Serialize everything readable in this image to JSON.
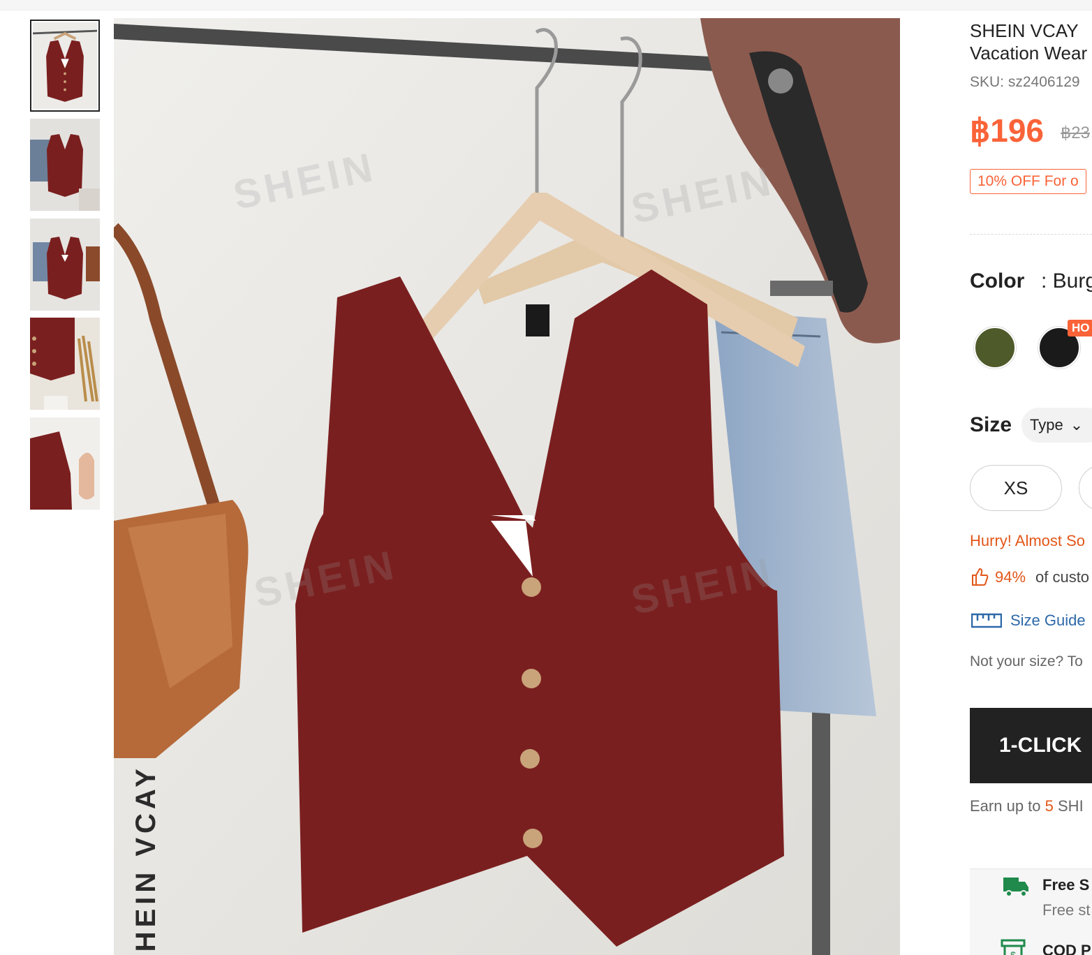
{
  "thumbnails": [
    {
      "alt": "Vest front view"
    },
    {
      "alt": "Vest with skirt"
    },
    {
      "alt": "Vest outfit"
    },
    {
      "alt": "Vest detail"
    },
    {
      "alt": "Vest fabric"
    }
  ],
  "watermark": "SHEIN",
  "brand_logo": "SHEIN VCAY",
  "product": {
    "title_line1": "SHEIN VCAY",
    "title_line2": "Vacation Wear",
    "sku": "SKU: sz2406129",
    "price": "฿196",
    "old_price": "฿23",
    "promo": "10% OFF For o"
  },
  "color": {
    "label": "Color",
    "value": ": Burg",
    "swatches": [
      "#4e5a2a",
      "#1a1a1a"
    ],
    "hot_badge": "HO"
  },
  "size": {
    "label": "Size",
    "type_label": "Type",
    "options": [
      "XS",
      ""
    ]
  },
  "hurry": "Hurry! Almost So",
  "fit": {
    "percent": "94%",
    "text": "of custo"
  },
  "size_guide": "Size Guide",
  "not_your_size": "Not your size? To",
  "one_click": "1-CLICK",
  "earn": {
    "prefix": "Earn up to ",
    "number": "5",
    "suffix": " SHI"
  },
  "shipping": {
    "title": "Free S",
    "sub": "Free st",
    "cod": "COD P"
  },
  "colors": {
    "accent": "#fa6338",
    "vest": "#7a1f1f",
    "link": "#2d68a8",
    "shipping_green": "#1f8a4c"
  }
}
